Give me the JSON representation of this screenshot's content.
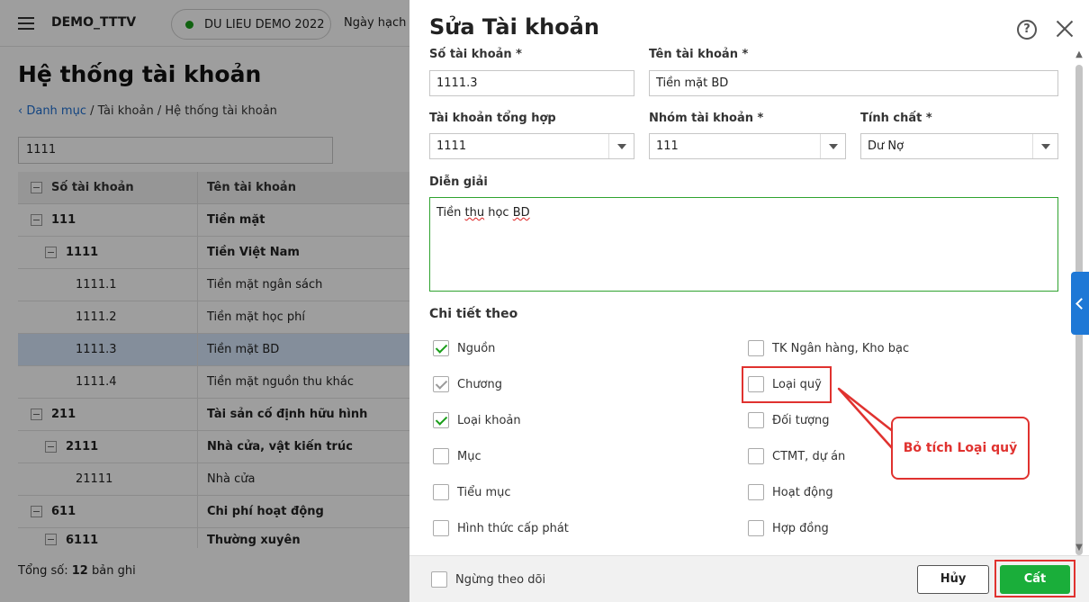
{
  "app": {
    "brand": "DEMO_TTTV",
    "database": "DU LIEU DEMO 2022",
    "date_label": "Ngày hạch t",
    "page_title": "Hệ thống tài khoản",
    "breadcrumb": {
      "back": "Danh mục",
      "mid": " / Tài khoản / ",
      "current": "Hệ thống tài khoản"
    },
    "search_value": "1111",
    "grid": {
      "col_account": "Số tài khoản",
      "col_name": "Tên tài khoản",
      "rows": [
        {
          "code": "111",
          "name": "Tiền mặt"
        },
        {
          "code": "1111",
          "name": "Tiền Việt Nam"
        },
        {
          "code": "1111.1",
          "name": "Tiền mặt ngân sách"
        },
        {
          "code": "1111.2",
          "name": "Tiền mặt học phí"
        },
        {
          "code": "1111.3",
          "name": "Tiền mặt BD"
        },
        {
          "code": "1111.4",
          "name": "Tiền mặt nguồn thu khác"
        },
        {
          "code": "211",
          "name": "Tài sản cố định hữu hình"
        },
        {
          "code": "2111",
          "name": "Nhà cửa, vật kiến trúc"
        },
        {
          "code": "21111",
          "name": "Nhà cửa"
        },
        {
          "code": "611",
          "name": "Chi phí hoạt động"
        },
        {
          "code": "6111",
          "name": "Thường xuyên"
        }
      ]
    },
    "total_label": "Tổng số: ",
    "total_count": "12",
    "total_suffix": " bản ghi"
  },
  "dialog": {
    "title": "Sửa Tài khoản",
    "help_glyph": "?",
    "fields": {
      "account_no_label": "Số tài khoản *",
      "account_no_value": "1111.3",
      "account_name_label": "Tên tài khoản *",
      "account_name_value": "Tiền mặt BD",
      "parent_label": "Tài khoản tổng hợp",
      "parent_value": "1111",
      "group_label": "Nhóm tài khoản *",
      "group_value": "111",
      "nature_label": "Tính chất *",
      "nature_value": "Dư Nợ",
      "desc_label": "Diễn giải",
      "desc_part1": "Tiền ",
      "desc_part2": "thu",
      "desc_part3": " học ",
      "desc_part4": "BD"
    },
    "detail_title": "Chi tiết theo",
    "left_checks": [
      {
        "label": "Nguồn",
        "checked": true
      },
      {
        "label": "Chương",
        "checked": true
      },
      {
        "label": "Loại khoản",
        "checked": true
      },
      {
        "label": "Mục",
        "checked": false
      },
      {
        "label": "Tiểu mục",
        "checked": false
      },
      {
        "label": "Hình thức cấp phát",
        "checked": false
      }
    ],
    "right_checks": [
      {
        "label": "TK Ngân hàng, Kho bạc",
        "checked": false
      },
      {
        "label": "Loại quỹ",
        "checked": false
      },
      {
        "label": "Đối tượng",
        "checked": false
      },
      {
        "label": "CTMT, dự án",
        "checked": false
      },
      {
        "label": "Hoạt động",
        "checked": false
      },
      {
        "label": "Hợp đồng",
        "checked": false
      }
    ],
    "stop_tracking_label": "Ngừng theo dõi",
    "cancel_label": "Hủy",
    "save_label": "Cất"
  },
  "annotation": {
    "callout_text": "Bỏ tích Loại quỹ",
    "color": "#e0322f"
  },
  "colors": {
    "accent_blue": "#1e78d6",
    "save_green": "#1aae3a",
    "check_green": "#1a9e1a",
    "selected_row": "#d6e6fb"
  }
}
